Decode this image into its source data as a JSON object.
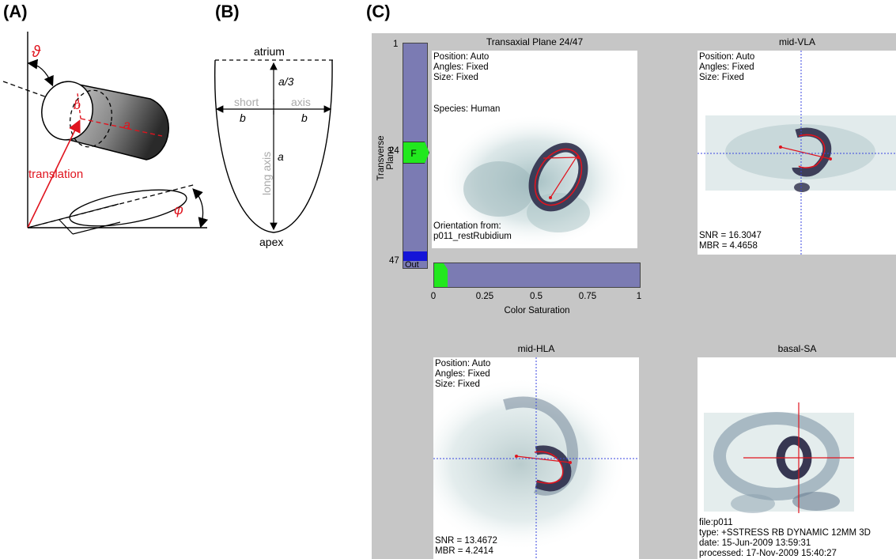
{
  "labels": {
    "a": "(A)",
    "b": "(B)",
    "c": "(C)"
  },
  "panelA": {
    "theta": "ϑ",
    "b": "b",
    "a": "a",
    "translation": "translation",
    "phi": "φ"
  },
  "panelB": {
    "atrium": "atrium",
    "apex": "apex",
    "a_third": "a/3",
    "short": "short",
    "axis": "axis",
    "b_left": "b",
    "b_right": "b",
    "a": "a",
    "long_axis": "long axis"
  },
  "panelC": {
    "transaxial": {
      "title": "Transaxial Plane 24/47",
      "position": "Position: Auto",
      "angles": "Angles: Fixed",
      "size": "Size: Fixed",
      "species": "Species: Human",
      "orientation_from": "Orientation from:",
      "orientation_file": "p011_restRubidium"
    },
    "slider": {
      "axis_label": "Transverse Plane",
      "top": "1",
      "mid": "24",
      "bottom": "47",
      "handle": "F",
      "out": "Out"
    },
    "color_saturation": {
      "label": "Color Saturation",
      "ticks": [
        "0",
        "0.25",
        "0.5",
        "0.75",
        "1"
      ],
      "value": 0.05
    },
    "mid_vla": {
      "title": "mid-VLA",
      "position": "Position: Auto",
      "angles": "Angles: Fixed",
      "size": "Size: Fixed",
      "snr": "SNR = 16.3047",
      "mbr": "MBR = 4.4658"
    },
    "mid_hla": {
      "title": "mid-HLA",
      "position": "Position: Auto",
      "angles": "Angles: Fixed",
      "size": "Size: Fixed",
      "snr": "SNR = 13.4672",
      "mbr": "MBR = 4.2414"
    },
    "basal_sa": {
      "title": "basal-SA",
      "file": "file:p011",
      "type": "type: +SSTRESS RB DYNAMIC 12MM 3D",
      "date": "date: 15-Jun-2009 13:59:31",
      "processed": "processed: 17-Nov-2009 15:40:27"
    }
  },
  "colors": {
    "red": "#e0141e",
    "slider_fill": "#7b7bb3",
    "slider_handle": "#22e81e",
    "slider_out": "#1414d8",
    "panel_bg": "#c6c6c6",
    "uptake": "#2d2d4a"
  }
}
